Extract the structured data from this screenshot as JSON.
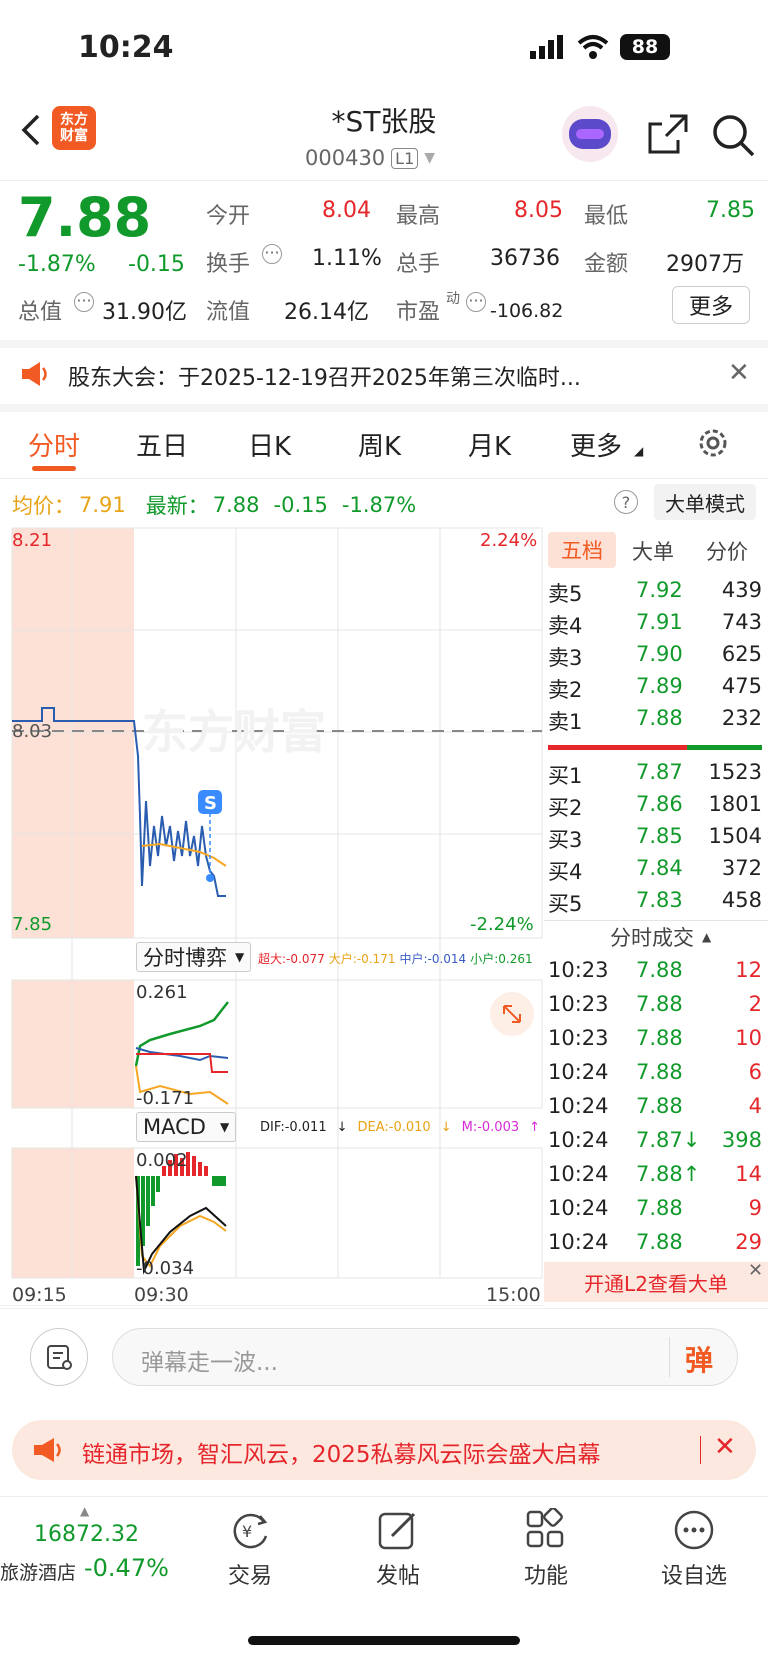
{
  "status": {
    "time": "10:24",
    "battery": "88"
  },
  "header": {
    "logo": "东方\n财富",
    "title": "*ST张股",
    "code": "000430",
    "level": "L1"
  },
  "quote": {
    "price": "7.88",
    "pct": "-1.87%",
    "chg": "-0.15",
    "open_l": "今开",
    "open_v": "8.04",
    "high_l": "最高",
    "high_v": "8.05",
    "low_l": "最低",
    "low_v": "7.85",
    "turn_l": "换手",
    "turn_v": "1.11%",
    "vol_l": "总手",
    "vol_v": "36736",
    "amt_l": "金额",
    "amt_v": "2907万",
    "mcap_l": "总值",
    "mcap_v": "31.90亿",
    "float_l": "流值",
    "float_v": "26.14亿",
    "pe_l": "市盈",
    "pe_sup": "动",
    "pe_v": "-106.82",
    "more": "更多"
  },
  "notice": {
    "text": "股东大会：于2025-12-19召开2025年第三次临时..."
  },
  "tabs": [
    "分时",
    "五日",
    "日K",
    "周K",
    "月K",
    "更多"
  ],
  "info": {
    "avg_l": "均价：",
    "avg_v": "7.91",
    "last_l": "最新：",
    "last_v": "7.88",
    "chg": "-0.15",
    "pct": "-1.87%",
    "mode": "大单模式"
  },
  "chart": {
    "max": "8.21",
    "min": "7.85",
    "pre": "8.03",
    "up": "2.24%",
    "down": "-2.24%",
    "watermark": "东方财富",
    "badge": "S",
    "t_start": "09:15",
    "t_mid": "09:30",
    "t_end": "15:00"
  },
  "game": {
    "label": "分时博弈",
    "super": "超大:-0.077",
    "big": "大户:-0.171",
    "mid": "中户:-0.014",
    "small": "小户:0.261",
    "top": "0.261",
    "bot": "-0.171"
  },
  "macd": {
    "label": "MACD",
    "dif": "DIF:-0.011",
    "dea": "DEA:-0.010",
    "m": "M:-0.003",
    "top": "0.002",
    "bot": "-0.034"
  },
  "chart_data": {
    "type": "line",
    "series": [
      {
        "name": "均价",
        "values": []
      }
    ],
    "ylim": [
      7.85,
      8.21
    ]
  },
  "ob_tabs": [
    "五档",
    "大单",
    "分价"
  ],
  "sell": [
    {
      "l": "卖5",
      "p": "7.92",
      "v": "439"
    },
    {
      "l": "卖4",
      "p": "7.91",
      "v": "743"
    },
    {
      "l": "卖3",
      "p": "7.90",
      "v": "625"
    },
    {
      "l": "卖2",
      "p": "7.89",
      "v": "475"
    },
    {
      "l": "卖1",
      "p": "7.88",
      "v": "232"
    }
  ],
  "buy": [
    {
      "l": "买1",
      "p": "7.87",
      "v": "1523"
    },
    {
      "l": "买2",
      "p": "7.86",
      "v": "1801"
    },
    {
      "l": "买3",
      "p": "7.85",
      "v": "1504"
    },
    {
      "l": "买4",
      "p": "7.84",
      "v": "372"
    },
    {
      "l": "买5",
      "p": "7.83",
      "v": "458"
    }
  ],
  "ticks_title": "分时成交",
  "ticks": [
    {
      "t": "10:23",
      "p": "7.88",
      "v": "12"
    },
    {
      "t": "10:23",
      "p": "7.88",
      "v": "2"
    },
    {
      "t": "10:23",
      "p": "7.88",
      "v": "10"
    },
    {
      "t": "10:24",
      "p": "7.88",
      "v": "6"
    },
    {
      "t": "10:24",
      "p": "7.88",
      "v": "4"
    },
    {
      "t": "10:24",
      "p": "7.87↓",
      "v": "398"
    },
    {
      "t": "10:24",
      "p": "7.88↑",
      "v": "14"
    },
    {
      "t": "10:24",
      "p": "7.88",
      "v": "9"
    },
    {
      "t": "10:24",
      "p": "7.88",
      "v": "29"
    }
  ],
  "l2": "开通L2查看大单",
  "danmu": {
    "placeholder": "弹幕走一波...",
    "btn": "弹"
  },
  "banner": "链通市场，智汇风云，2025私募风云际会盛大启幕",
  "nav": {
    "index_v": "16872.32",
    "index_n": "旅游酒店",
    "index_p": "-0.47%",
    "trade": "交易",
    "post": "发帖",
    "func": "功能",
    "watch": "设自选"
  }
}
